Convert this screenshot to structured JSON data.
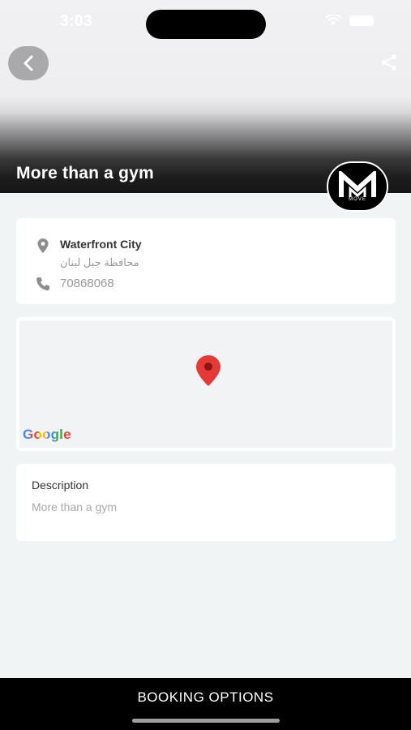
{
  "status_bar": {
    "time": "3:03"
  },
  "header": {
    "title": "More than a gym",
    "logo_text": "MOVE"
  },
  "info": {
    "address_title": "Waterfront City",
    "address_subtitle": "محافظة جبل لبنان",
    "phone": "70868068"
  },
  "map": {
    "attribution": "Google",
    "pin_color": "#e53935"
  },
  "description": {
    "title": "Description",
    "text": "More than a gym"
  },
  "footer": {
    "booking_label": "BOOKING OPTIONS"
  },
  "colors": {
    "accent": "#000000",
    "card_bg": "#ffffff",
    "page_bg": "#f1f4f4"
  }
}
